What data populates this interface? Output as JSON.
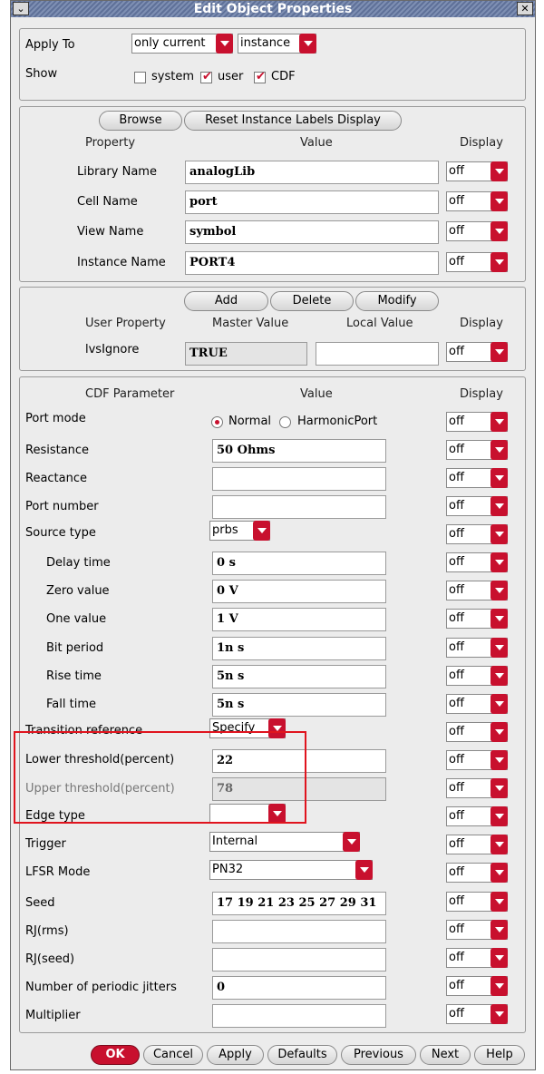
{
  "window": {
    "title": "Edit Object Properties",
    "menu_glyph": "⌄",
    "close_glyph": "✕"
  },
  "top": {
    "apply_to_label": "Apply To",
    "apply_to_scope": "only current",
    "apply_to_target": "instance",
    "show_label": "Show",
    "show_options": [
      {
        "label": "system",
        "checked": false
      },
      {
        "label": "user",
        "checked": true
      },
      {
        "label": "CDF",
        "checked": true
      }
    ]
  },
  "props": {
    "browse_label": "Browse",
    "reset_label": "Reset Instance Labels Display",
    "col_property": "Property",
    "col_value": "Value",
    "col_display": "Display",
    "rows": [
      {
        "label": "Library Name",
        "value": "analogLib",
        "display": "off"
      },
      {
        "label": "Cell Name",
        "value": "port",
        "display": "off"
      },
      {
        "label": "View Name",
        "value": "symbol",
        "display": "off"
      },
      {
        "label": "Instance Name",
        "value": "PORT4",
        "display": "off"
      }
    ]
  },
  "user": {
    "add_label": "Add",
    "delete_label": "Delete",
    "modify_label": "Modify",
    "col_user_property": "User Property",
    "col_master_value": "Master Value",
    "col_local_value": "Local Value",
    "col_display": "Display",
    "row": {
      "label": "lvsIgnore",
      "master": "TRUE",
      "local": "",
      "display": "off"
    }
  },
  "cdf": {
    "col_param": "CDF Parameter",
    "col_value": "Value",
    "col_display": "Display",
    "port_mode": {
      "label": "Port mode",
      "normal": "Normal",
      "harmonic": "HarmonicPort",
      "display": "off"
    },
    "resistance": {
      "label": "Resistance",
      "value": "50 Ohms",
      "display": "off"
    },
    "reactance": {
      "label": "Reactance",
      "value": "",
      "display": "off"
    },
    "port_number": {
      "label": "Port number",
      "value": "",
      "display": "off"
    },
    "source_type": {
      "label": "Source type",
      "value": "prbs",
      "display": "off"
    },
    "delay_time": {
      "label": "Delay time",
      "value": "0 s",
      "display": "off"
    },
    "zero_value": {
      "label": "Zero value",
      "value": "0 V",
      "display": "off"
    },
    "one_value": {
      "label": "One value",
      "value": "1 V",
      "display": "off"
    },
    "bit_period": {
      "label": "Bit period",
      "value": "1n s",
      "display": "off"
    },
    "rise_time": {
      "label": "Rise time",
      "value": "5n s",
      "display": "off"
    },
    "fall_time": {
      "label": "Fall time",
      "value": "5n s",
      "display": "off"
    },
    "transition_reference": {
      "label": "Transition reference",
      "value": "Specify",
      "display": "off"
    },
    "lower_threshold": {
      "label": "Lower threshold(percent)",
      "value": "22",
      "display": "off"
    },
    "upper_threshold": {
      "label": "Upper threshold(percent)",
      "value": "78",
      "display": "off"
    },
    "edge_type": {
      "label": "Edge type",
      "value": "",
      "display": "off"
    },
    "trigger": {
      "label": "Trigger",
      "value": "Internal",
      "display": "off"
    },
    "lfsr_mode": {
      "label": "LFSR Mode",
      "value": "PN32",
      "display": "off"
    },
    "seed": {
      "label": "Seed",
      "value": "17 19 21 23 25 27 29 31",
      "display": "off"
    },
    "rj_rms": {
      "label": "RJ(rms)",
      "value": "",
      "display": "off"
    },
    "rj_seed": {
      "label": "RJ(seed)",
      "value": "",
      "display": "off"
    },
    "periodic_jitters": {
      "label": "Number of periodic jitters",
      "value": "0",
      "display": "off"
    },
    "multiplier": {
      "label": "Multiplier",
      "value": "",
      "display": "off"
    }
  },
  "footer": {
    "ok": "OK",
    "cancel": "Cancel",
    "apply": "Apply",
    "defaults": "Defaults",
    "previous": "Previous",
    "next": "Next",
    "help": "Help"
  },
  "colors": {
    "accent": "#c8102e",
    "title_bar": "#6f81a6",
    "highlight_box": "#e0141e"
  }
}
